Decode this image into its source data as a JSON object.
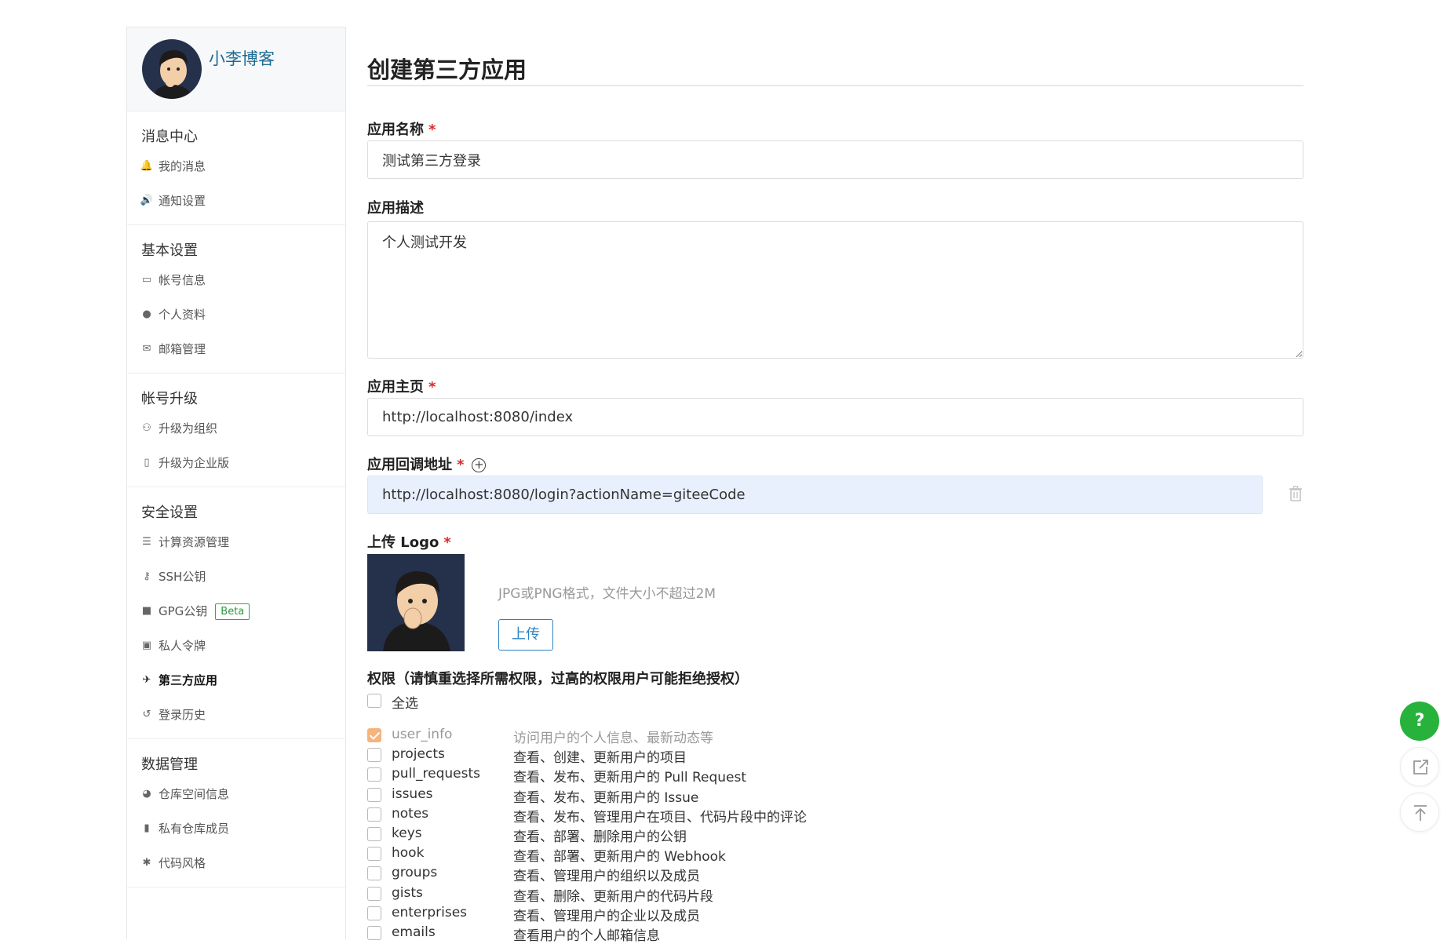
{
  "sidebar": {
    "username": "小李博客",
    "groups": [
      {
        "title": "消息中心",
        "items": [
          {
            "label": "我的消息",
            "icon": "bell-icon"
          },
          {
            "label": "通知设置",
            "icon": "speaker-icon"
          }
        ]
      },
      {
        "title": "基本设置",
        "items": [
          {
            "label": "帐号信息",
            "icon": "id-card-icon"
          },
          {
            "label": "个人资料",
            "icon": "user-icon"
          },
          {
            "label": "邮箱管理",
            "icon": "mail-icon"
          }
        ]
      },
      {
        "title": "帐号升级",
        "items": [
          {
            "label": "升级为组织",
            "icon": "users-icon"
          },
          {
            "label": "升级为企业版",
            "icon": "building-icon"
          }
        ]
      },
      {
        "title": "安全设置",
        "items": [
          {
            "label": "计算资源管理",
            "icon": "server-icon"
          },
          {
            "label": "SSH公钥",
            "icon": "key-icon"
          },
          {
            "label": "GPG公钥",
            "icon": "lock-icon",
            "badge": "Beta"
          },
          {
            "label": "私人令牌",
            "icon": "token-icon"
          },
          {
            "label": "第三方应用",
            "icon": "rocket-icon",
            "active": true
          },
          {
            "label": "登录历史",
            "icon": "history-icon"
          }
        ]
      },
      {
        "title": "数据管理",
        "items": [
          {
            "label": "仓库空间信息",
            "icon": "pie-chart-icon"
          },
          {
            "label": "私有仓库成员",
            "icon": "book-icon"
          },
          {
            "label": "代码风格",
            "icon": "palette-icon"
          }
        ]
      }
    ]
  },
  "form": {
    "page_title": "创建第三方应用",
    "required_mark": "*",
    "app_name": {
      "label": "应用名称",
      "value": "测试第三方登录"
    },
    "app_desc": {
      "label": "应用描述",
      "value": "个人测试开发"
    },
    "homepage": {
      "label": "应用主页",
      "value": "http://localhost:8080/index"
    },
    "callback": {
      "label": "应用回调地址",
      "value": "http://localhost:8080/login?actionName=giteeCode",
      "add_icon": "+"
    },
    "logo": {
      "label": "上传 Logo",
      "hint": "JPG或PNG格式，文件大小不超过2M",
      "upload_label": "上传"
    },
    "permissions": {
      "title": "权限（请慎重选择所需权限，过高的权限用户可能拒绝授权）",
      "select_all": "全选",
      "items": [
        {
          "name": "user_info",
          "desc": "访问用户的个人信息、最新动态等",
          "checked": true,
          "disabled": true
        },
        {
          "name": "projects",
          "desc": "查看、创建、更新用户的项目",
          "checked": false
        },
        {
          "name": "pull_requests",
          "desc": "查看、发布、更新用户的 Pull Request",
          "checked": false
        },
        {
          "name": "issues",
          "desc": "查看、发布、更新用户的 Issue",
          "checked": false
        },
        {
          "name": "notes",
          "desc": "查看、发布、管理用户在项目、代码片段中的评论",
          "checked": false
        },
        {
          "name": "keys",
          "desc": "查看、部署、删除用户的公钥",
          "checked": false
        },
        {
          "name": "hook",
          "desc": "查看、部署、更新用户的 Webhook",
          "checked": false
        },
        {
          "name": "groups",
          "desc": "查看、管理用户的组织以及成员",
          "checked": false
        },
        {
          "name": "gists",
          "desc": "查看、删除、更新用户的代码片段",
          "checked": false
        },
        {
          "name": "enterprises",
          "desc": "查看、管理用户的企业以及成员",
          "checked": false
        },
        {
          "name": "emails",
          "desc": "查看用户的个人邮箱信息",
          "checked": false
        }
      ]
    }
  },
  "floating": {
    "help_label": "?"
  },
  "colors": {
    "accent": "#1c6b94",
    "success": "#27b23c",
    "required": "#db2828",
    "checked": "#f6b37b",
    "autofill": "#e8f0fe"
  }
}
